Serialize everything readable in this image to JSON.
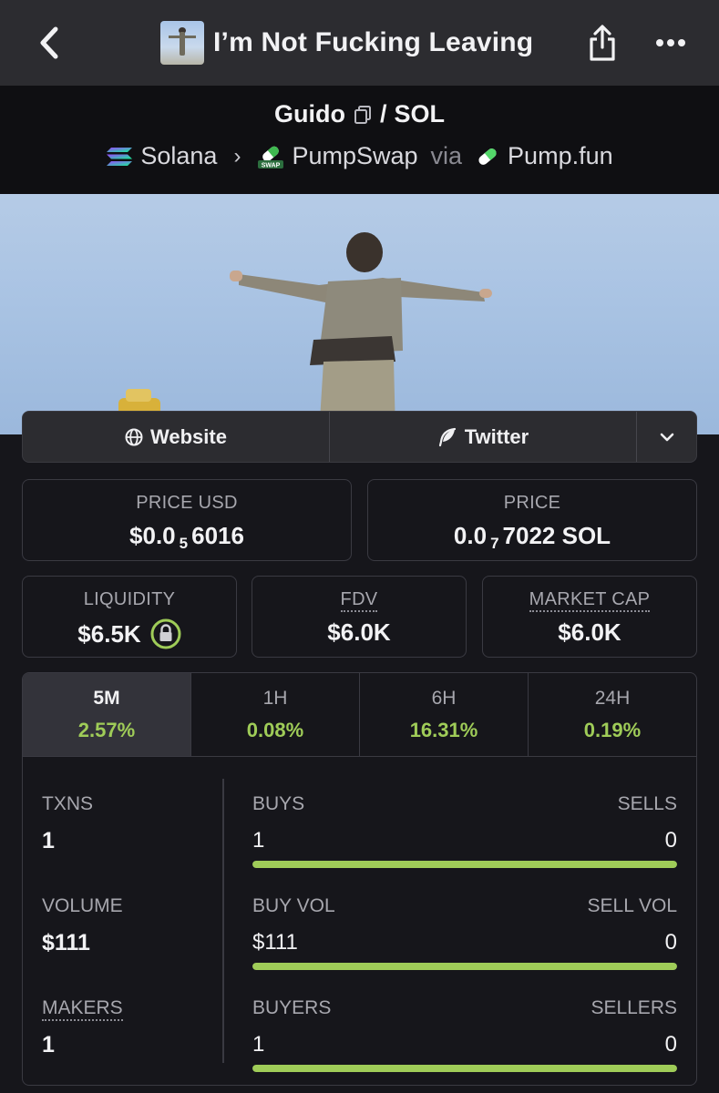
{
  "header": {
    "title": "I’m Not Fucking Leaving",
    "icons": {
      "back": "chevron-left-icon",
      "share": "share-icon",
      "more": "more-horizontal-icon"
    }
  },
  "pair": {
    "base": "Guido",
    "separator": "/",
    "quote": "SOL",
    "chain": "Solana",
    "dex": "PumpSwap",
    "dex_badge": "SWAP",
    "via_label": "via",
    "launchpad": "Pump.fun"
  },
  "links": {
    "website": "Website",
    "twitter": "Twitter"
  },
  "prices": {
    "price_usd_label": "PRICE USD",
    "price_usd_prefix": "$0.0",
    "price_usd_zeros": "5",
    "price_usd_digits": "6016",
    "price_label": "PRICE",
    "price_prefix": "0.0",
    "price_zeros": "7",
    "price_digits": "7022 SOL",
    "liquidity_label": "LIQUIDITY",
    "liquidity_value": "$6.5K",
    "fdv_label": "FDV",
    "fdv_value": "$6.0K",
    "mcap_label": "MARKET CAP",
    "mcap_value": "$6.0K"
  },
  "timeframes": [
    {
      "label": "5M",
      "change": "2.57%",
      "active": true
    },
    {
      "label": "1H",
      "change": "0.08%",
      "active": false
    },
    {
      "label": "6H",
      "change": "16.31%",
      "active": false
    },
    {
      "label": "24H",
      "change": "0.19%",
      "active": false
    }
  ],
  "metrics": {
    "txns": {
      "label": "TXNS",
      "value": "1",
      "left_label": "BUYS",
      "right_label": "SELLS",
      "left_value": "1",
      "right_value": "0",
      "fill": 1.0
    },
    "volume": {
      "label": "VOLUME",
      "value": "$111",
      "left_label": "BUY VOL",
      "right_label": "SELL VOL",
      "left_value": "$111",
      "right_value": "0",
      "fill": 1.0
    },
    "makers": {
      "label": "MAKERS",
      "value": "1",
      "left_label": "BUYERS",
      "right_label": "SELLERS",
      "left_value": "1",
      "right_value": "0",
      "fill": 1.0
    }
  },
  "colors": {
    "positive": "#9fcc58",
    "background": "#16161b",
    "panel": "#2c2c30"
  }
}
